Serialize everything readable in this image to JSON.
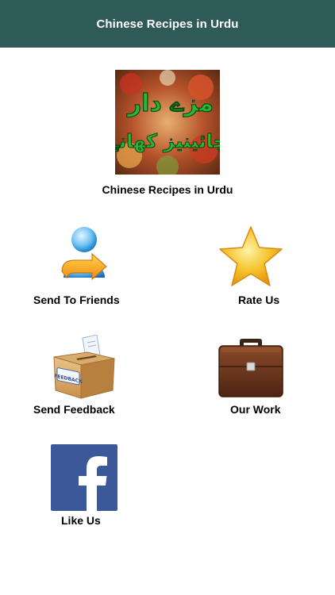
{
  "header": {
    "title": "Chinese Recipes in Urdu"
  },
  "app": {
    "logo_icon": "recipe-logo-icon",
    "logo_urdu_line1": "مزے دار",
    "logo_urdu_line2": "چائینیز کھانے",
    "caption": "Chinese Recipes in Urdu"
  },
  "menu": {
    "send_to_friends": {
      "label": "Send To Friends",
      "icon": "user-share-icon"
    },
    "rate_us": {
      "label": "Rate Us",
      "icon": "star-icon"
    },
    "send_feedback": {
      "label": "Send Feedback",
      "icon": "feedback-box-icon"
    },
    "our_work": {
      "label": "Our Work",
      "icon": "briefcase-icon"
    },
    "like_us": {
      "label": "Like Us",
      "icon": "facebook-icon"
    }
  },
  "colors": {
    "header_bg": "#2e5a57",
    "header_text": "#ffffff",
    "star_gold": "#f5b81a",
    "facebook_blue": "#3b5998",
    "briefcase_brown": "#6b3a22"
  }
}
